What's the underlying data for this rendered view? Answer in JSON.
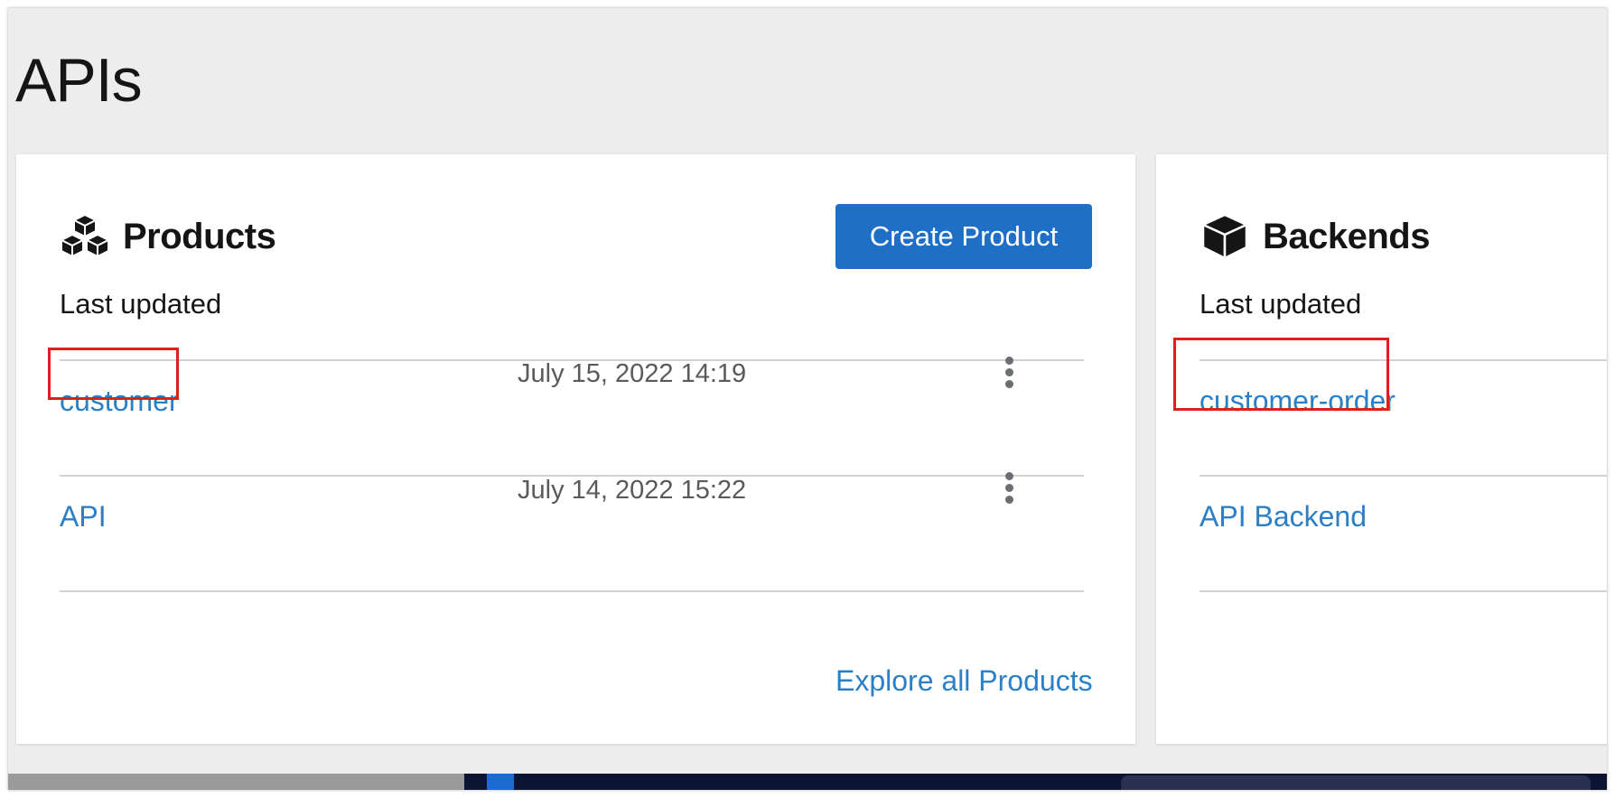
{
  "page": {
    "title": "APIs"
  },
  "products": {
    "title": "Products",
    "icon": "cubes-icon",
    "subtitle": "Last updated",
    "create_label": "Create Product",
    "rows": [
      {
        "name": "customer",
        "date": "July 15, 2022 14:19",
        "highlighted": true
      },
      {
        "name": "API",
        "date": "July 14, 2022 15:22",
        "highlighted": false
      }
    ],
    "explore_label": "Explore all Products"
  },
  "backends": {
    "title": "Backends",
    "icon": "cube-icon",
    "subtitle": "Last updated",
    "rows": [
      {
        "name": "customer-order",
        "highlighted": true
      },
      {
        "name": "API Backend",
        "highlighted": false
      }
    ]
  },
  "colors": {
    "accent": "#1f6fc7",
    "link": "#2b7fc7",
    "highlight": "#e01e1e",
    "page_bg": "#ededed"
  }
}
